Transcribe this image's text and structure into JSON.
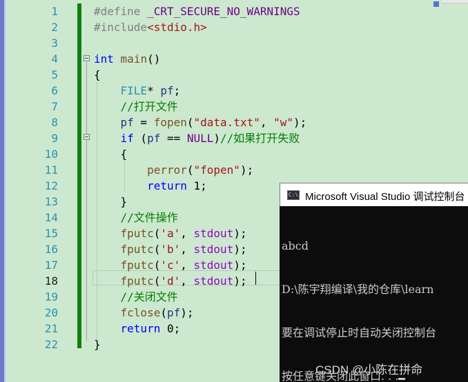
{
  "editor": {
    "line_numbers": [
      "1",
      "2",
      "3",
      "4",
      "5",
      "6",
      "7",
      "8",
      "9",
      "10",
      "11",
      "12",
      "13",
      "14",
      "15",
      "16",
      "17",
      "18",
      "19",
      "20",
      "21",
      "22"
    ],
    "current_line": "18",
    "lines": [
      [
        {
          "t": "#define ",
          "c": "pp"
        },
        {
          "t": "_CRT_SECURE_NO_WARNINGS",
          "c": "macro"
        }
      ],
      [
        {
          "t": "#include",
          "c": "pp"
        },
        {
          "t": "<stdio.h>",
          "c": "str"
        }
      ],
      [],
      [
        {
          "t": "int",
          "c": "kw"
        },
        {
          "t": " ",
          "c": ""
        },
        {
          "t": "main",
          "c": "fn"
        },
        {
          "t": "()",
          "c": ""
        }
      ],
      [
        {
          "t": "{",
          "c": ""
        }
      ],
      [
        {
          "t": "    ",
          "c": ""
        },
        {
          "t": "FILE",
          "c": "type"
        },
        {
          "t": "* ",
          "c": ""
        },
        {
          "t": "pf",
          "c": "var"
        },
        {
          "t": ";",
          "c": ""
        }
      ],
      [
        {
          "t": "    ",
          "c": ""
        },
        {
          "t": "//打开文件",
          "c": "cmt"
        }
      ],
      [
        {
          "t": "    ",
          "c": ""
        },
        {
          "t": "pf",
          "c": "var"
        },
        {
          "t": " = ",
          "c": ""
        },
        {
          "t": "fopen",
          "c": "fn"
        },
        {
          "t": "(",
          "c": ""
        },
        {
          "t": "\"data.txt\"",
          "c": "str"
        },
        {
          "t": ", ",
          "c": ""
        },
        {
          "t": "\"w\"",
          "c": "str"
        },
        {
          "t": ");",
          "c": ""
        }
      ],
      [
        {
          "t": "    ",
          "c": ""
        },
        {
          "t": "if",
          "c": "kw"
        },
        {
          "t": " (",
          "c": ""
        },
        {
          "t": "pf",
          "c": "var"
        },
        {
          "t": " == ",
          "c": ""
        },
        {
          "t": "NULL",
          "c": "macro"
        },
        {
          "t": ")",
          "c": ""
        },
        {
          "t": "//如果打开失败",
          "c": "cmt"
        }
      ],
      [
        {
          "t": "    {",
          "c": ""
        }
      ],
      [
        {
          "t": "        ",
          "c": ""
        },
        {
          "t": "perror",
          "c": "fn"
        },
        {
          "t": "(",
          "c": ""
        },
        {
          "t": "\"fopen\"",
          "c": "str"
        },
        {
          "t": ");",
          "c": ""
        }
      ],
      [
        {
          "t": "        ",
          "c": ""
        },
        {
          "t": "return",
          "c": "kw"
        },
        {
          "t": " 1;",
          "c": ""
        }
      ],
      [
        {
          "t": "    }",
          "c": ""
        }
      ],
      [
        {
          "t": "    ",
          "c": ""
        },
        {
          "t": "//文件操作",
          "c": "cmt"
        }
      ],
      [
        {
          "t": "    ",
          "c": ""
        },
        {
          "t": "fputc",
          "c": "fn"
        },
        {
          "t": "(",
          "c": ""
        },
        {
          "t": "'a'",
          "c": "str"
        },
        {
          "t": ", ",
          "c": ""
        },
        {
          "t": "stdout",
          "c": "kw2"
        },
        {
          "t": ");",
          "c": ""
        }
      ],
      [
        {
          "t": "    ",
          "c": ""
        },
        {
          "t": "fputc",
          "c": "fn"
        },
        {
          "t": "(",
          "c": ""
        },
        {
          "t": "'b'",
          "c": "str"
        },
        {
          "t": ", ",
          "c": ""
        },
        {
          "t": "stdout",
          "c": "kw2"
        },
        {
          "t": ");",
          "c": ""
        }
      ],
      [
        {
          "t": "    ",
          "c": ""
        },
        {
          "t": "fputc",
          "c": "fn"
        },
        {
          "t": "(",
          "c": ""
        },
        {
          "t": "'c'",
          "c": "str"
        },
        {
          "t": ", ",
          "c": ""
        },
        {
          "t": "stdout",
          "c": "kw2"
        },
        {
          "t": ");",
          "c": ""
        }
      ],
      [
        {
          "t": "    ",
          "c": ""
        },
        {
          "t": "fputc",
          "c": "fn"
        },
        {
          "t": "(",
          "c": ""
        },
        {
          "t": "'d'",
          "c": "str"
        },
        {
          "t": ", ",
          "c": ""
        },
        {
          "t": "stdout",
          "c": "kw2"
        },
        {
          "t": ");",
          "c": ""
        }
      ],
      [
        {
          "t": "    ",
          "c": ""
        },
        {
          "t": "//关闭文件",
          "c": "cmt"
        }
      ],
      [
        {
          "t": "    ",
          "c": ""
        },
        {
          "t": "fclose",
          "c": "fn"
        },
        {
          "t": "(",
          "c": ""
        },
        {
          "t": "pf",
          "c": "var"
        },
        {
          "t": ");",
          "c": ""
        }
      ],
      [
        {
          "t": "    ",
          "c": ""
        },
        {
          "t": "return",
          "c": "kw"
        },
        {
          "t": " 0;",
          "c": ""
        }
      ],
      [
        {
          "t": "}",
          "c": ""
        }
      ]
    ]
  },
  "console": {
    "icon_label": "C:\\",
    "title": "Microsoft Visual Studio 调试控制台",
    "output": [
      "abcd",
      "D:\\陈宇翔编译\\我的仓库\\learn",
      "要在调试停止时自动关闭控制台",
      "按任意键关闭此窗口. . ."
    ]
  },
  "watermark": "CSDN @小陈在拼命",
  "colors": {
    "editor_bg": "#cce8cf",
    "line_number": "#2b91af",
    "keyword": "#0000ff",
    "comment": "#008000",
    "string": "#a31515",
    "change_bar": "#108010",
    "console_bg": "#0c0c0c"
  }
}
